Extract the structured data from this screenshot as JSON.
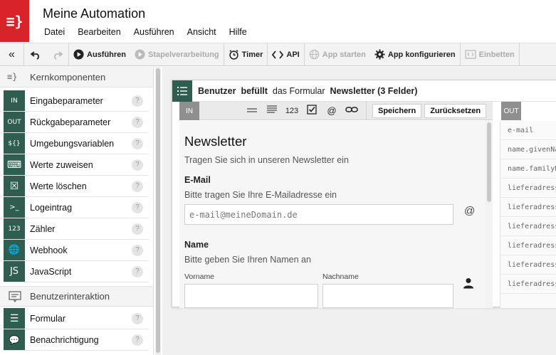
{
  "header": {
    "logo_glyph": "≡}",
    "title": "Meine Automation",
    "menu": [
      "Datei",
      "Bearbeiten",
      "Ausführen",
      "Ansicht",
      "Hilfe"
    ]
  },
  "toolbar": {
    "collapse_glyph": "«",
    "run_label": "Ausführen",
    "batch_label": "Stapelverarbeitung",
    "timer_label": "Timer",
    "api_label": "API",
    "app_start_label": "App starten",
    "app_config_label": "App konfigurieren",
    "embed_label": "Einbetten"
  },
  "sidebar": {
    "section1": {
      "icon": "≡}",
      "label": "Kernkomponenten"
    },
    "core_items": [
      {
        "icon": "IN",
        "label": "Eingabeparameter"
      },
      {
        "icon": "OUT",
        "label": "Rückgabeparameter"
      },
      {
        "icon": "${}",
        "label": "Umgebungsvariablen"
      },
      {
        "icon": "⌨",
        "label": "Werte zuweisen"
      },
      {
        "icon": "☒",
        "label": "Werte löschen"
      },
      {
        "icon": ">_",
        "label": "Logeintrag"
      },
      {
        "icon": "123",
        "label": "Zähler"
      },
      {
        "icon": "🌐",
        "label": "Webhook"
      },
      {
        "icon": "JS",
        "label": "JavaScript"
      }
    ],
    "section2": {
      "label": "Benutzerinteraktion"
    },
    "ui_items": [
      {
        "icon": "☰",
        "label": "Formular"
      },
      {
        "icon": "💬",
        "label": "Benachrichtigung"
      }
    ],
    "help_glyph": "?"
  },
  "node": {
    "subject": "Benutzer",
    "verb": "befüllt",
    "middle": "das Formular",
    "form_name": "Newsletter (3 Felder)",
    "in_label": "IN",
    "out_label": "OUT",
    "save_label": "Speichern",
    "reset_label": "Zurücksetzen",
    "number_glyph": "123",
    "at_glyph": "@"
  },
  "form": {
    "title": "Newsletter",
    "subtitle": "Tragen Sie sich in unseren Newsletter ein",
    "email_label": "E-Mail",
    "email_help": "Bitte tragen Sie Ihre E-Mailadresse ein",
    "email_placeholder": "e-mail@meineDomain.de",
    "email_at": "@",
    "name_label": "Name",
    "name_help": "Bitte geben Sie Ihren Namen an",
    "firstname_label": "Vorname",
    "lastname_label": "Nachname"
  },
  "outputs": [
    "e-mail",
    "name.givenName",
    "name.familyName",
    "lieferadresse",
    "lieferadresse",
    "lieferadresse",
    "lieferadresse",
    "lieferadresse",
    "lieferadresse"
  ]
}
